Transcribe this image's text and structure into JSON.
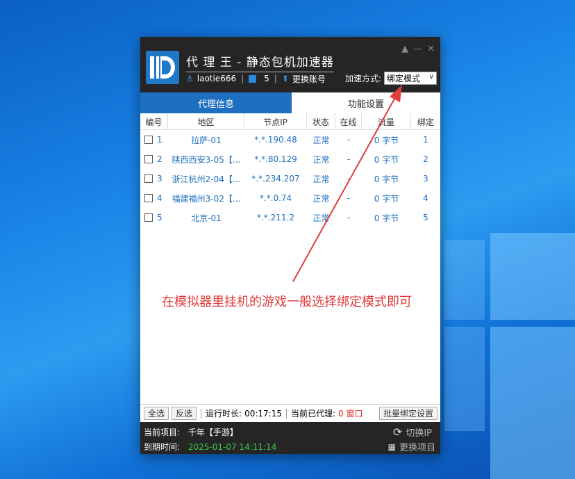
{
  "app": {
    "title": "代 理 王 - 静态包机加速器",
    "username": "laotie666",
    "count": "5",
    "switch_account": "更换账号",
    "mode_label": "加速方式:",
    "mode_value": "绑定模式"
  },
  "tabs": [
    {
      "label": "代理信息"
    },
    {
      "label": "功能设置"
    }
  ],
  "table": {
    "headers": [
      "编号",
      "地区",
      "节点IP",
      "状态",
      "在线",
      "流量",
      "绑定"
    ],
    "rows": [
      {
        "num": "1",
        "region": "拉萨-01",
        "ip": "*.*.190.48",
        "status": "正常",
        "online": "-",
        "traffic": "0 字节",
        "bind": "1"
      },
      {
        "num": "2",
        "region": "陕西西安3-05【...",
        "ip": "*.*.80.129",
        "status": "正常",
        "online": "-",
        "traffic": "0 字节",
        "bind": "2"
      },
      {
        "num": "3",
        "region": "浙江杭州2-04【...",
        "ip": "*.*.234.207",
        "status": "正常",
        "online": "-",
        "traffic": "0 字节",
        "bind": "3"
      },
      {
        "num": "4",
        "region": "福建福州3-02【...",
        "ip": "*.*.0.74",
        "status": "正常",
        "online": "-",
        "traffic": "0 字节",
        "bind": "4"
      },
      {
        "num": "5",
        "region": "北京-01",
        "ip": "*.*.211.2",
        "status": "正常",
        "online": "-",
        "traffic": "0 字节",
        "bind": "5"
      }
    ]
  },
  "annotation": "在模拟器里挂机的游戏一般选择绑定模式即可",
  "bottom_bar": {
    "select_all": "全选",
    "invert": "反选",
    "runtime_label": "运行时长:",
    "runtime_value": "00:17:15",
    "proxied_label": "当前已代理:",
    "proxied_value": "0 窗口",
    "bulk_bind": "批量绑定设置"
  },
  "footer": {
    "project_label": "当前项目:",
    "project_value": "千年【手游】",
    "expiry_label": "到期时间:",
    "expiry_value": "2025-01-07 14:11:14",
    "switch_ip": "切换IP",
    "change_project": "更换项目"
  },
  "colors": {
    "accent": "#1e6fc0",
    "annotation": "#e23b3b",
    "expiry": "#3ec64a"
  }
}
